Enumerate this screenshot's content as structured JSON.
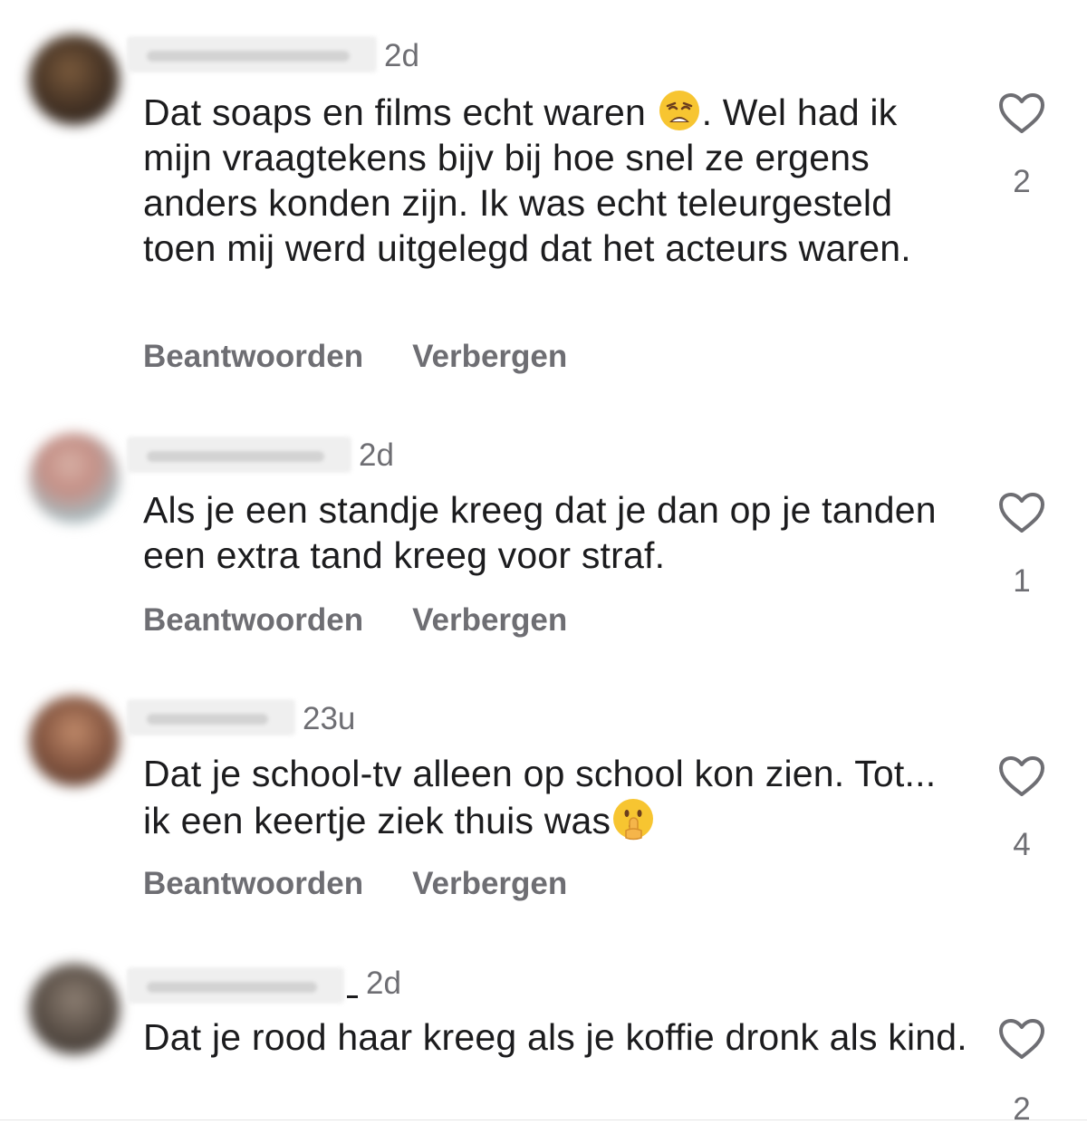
{
  "actions": {
    "reply_label": "Beantwoorden",
    "hide_label": "Verbergen"
  },
  "icons": {
    "like": "heart-outline-icon",
    "emoji_weary": "weary-face-emoji",
    "emoji_shush": "shushing-face-emoji"
  },
  "comments": [
    {
      "time": "2d",
      "text_before_emoji": "Dat soaps en films echt waren ",
      "text_after_emoji": ". Wel had ik mijn vraagtekens bijv bij hoe snel ze ergens anders konden zijn. Ik was echt teleurgesteld toen mij werd uitgelegd dat het acteurs waren.",
      "likes": "2"
    },
    {
      "time": "2d",
      "text": "Als je een standje kreeg dat je dan op je tanden een extra tand kreeg voor straf.",
      "likes": "1"
    },
    {
      "time": "23u",
      "text": "Dat je school-tv alleen op school kon zien. Tot... ik een keertje ziek thuis was",
      "likes": "4"
    },
    {
      "time": "2d",
      "text": "Dat je rood haar kreeg als je koffie dronk als kind.",
      "likes": "2"
    }
  ]
}
